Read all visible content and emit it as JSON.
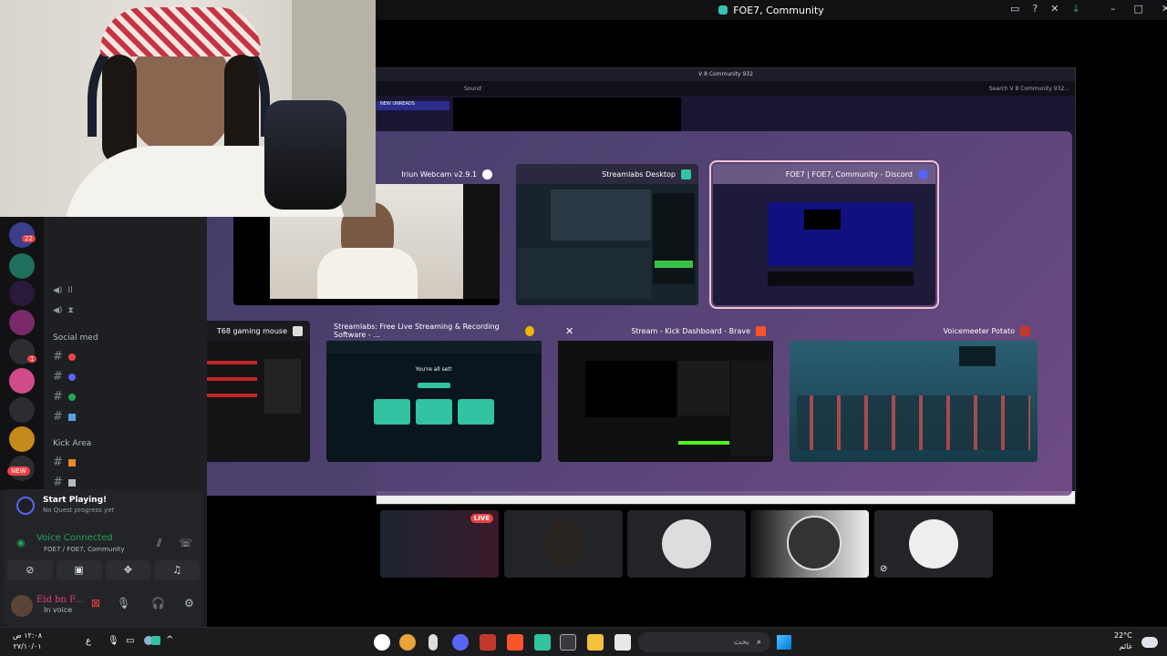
{
  "discord_window": {
    "title": "FOE7, Community",
    "inner_title": "V 8 Community 932",
    "inner_search": "Search V 8 Community 932...",
    "inner_channel": "Sound",
    "new_unreads": "NEW UNREADS"
  },
  "switcher": {
    "windows": [
      {
        "title": "Iriun Webcam v2.9.1"
      },
      {
        "title": "Streamlabs Desktop"
      },
      {
        "title": "FOE7 | FOE7, Community - Discord"
      },
      {
        "title": "T68 gaming mouse"
      },
      {
        "title": "Streamlabs: Free Live Streaming & Recording Software - ..."
      },
      {
        "title": "Stream - Kick Dashboard - Brave"
      },
      {
        "title": "Voicemeeter Potato"
      }
    ],
    "selected_index": 2,
    "streamlabs_web_heading": "You're all set!"
  },
  "sidebar": {
    "server_badges": [
      "22",
      "1",
      "NEW"
    ],
    "categories": [
      "Social med",
      "Kick Area"
    ],
    "quest": {
      "title": "Start Playing!",
      "subtitle": "No Quest progress yet"
    },
    "voice": {
      "status": "Voice Connected",
      "channel": "FOE7 / FOE7, Community"
    },
    "user": {
      "name": "Eid bn F...",
      "status": "In voice"
    }
  },
  "streams": {
    "live_label": "LIVE"
  },
  "taskbar": {
    "search_placeholder": "بحث",
    "time": "١٢:٠٨ ص",
    "date": "٢٧/١٠/٠١",
    "lang": "ع",
    "weather_temp": "22°C",
    "weather_desc": "غائم"
  },
  "colors": {
    "accent_discord": "#5865f2",
    "voice_green": "#23a55a",
    "live_red": "#ed4245",
    "selected_outline": "#f1c3d6"
  }
}
